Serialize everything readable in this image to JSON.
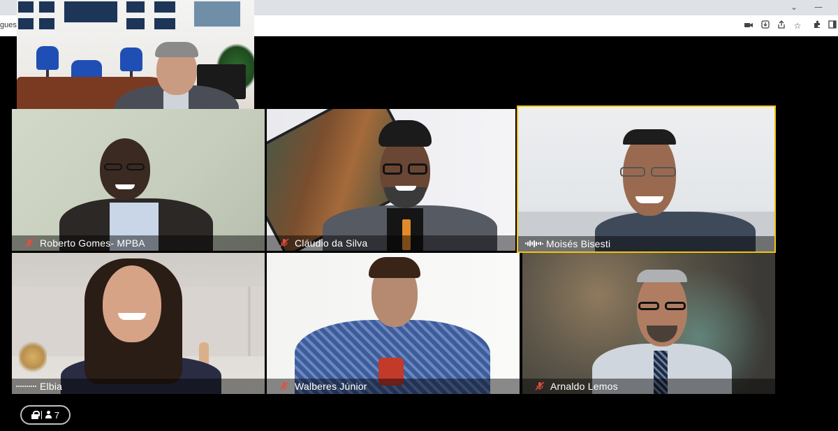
{
  "browser": {
    "url_fragment": "guest.",
    "window_minimize": "—",
    "window_chevron": "⌄",
    "toolbar_icons": [
      "camera-icon",
      "install-icon",
      "share-icon",
      "bookmark-star-icon",
      "extensions-icon",
      "side-panel-icon"
    ]
  },
  "tiles": [
    {
      "name": "Roberto Gomes- MPBA",
      "status": "muted"
    },
    {
      "name": "Cláudio da Silva",
      "status": "muted"
    },
    {
      "name": "Moisés Bisesti",
      "status": "speaking"
    },
    {
      "name": "Elbia",
      "status": "audio"
    },
    {
      "name": "Walberes Júnior",
      "status": "muted"
    },
    {
      "name": "Arnaldo Lemos",
      "status": "muted"
    }
  ],
  "participants": {
    "count": "7"
  },
  "colors": {
    "speaking_border": "#f1c40f",
    "muted_icon": "#e74c3c",
    "background": "#000000"
  }
}
